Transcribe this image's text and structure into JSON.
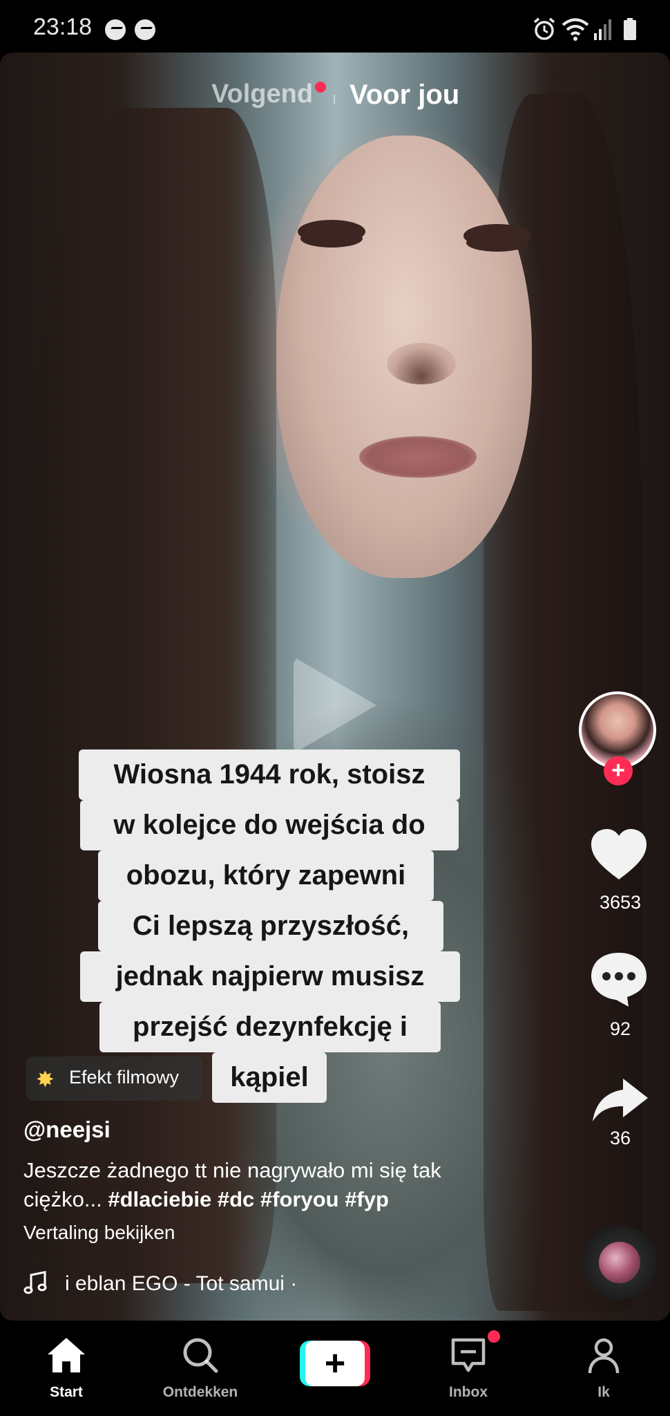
{
  "status_bar": {
    "time": "23:18",
    "left_icons": [
      "messenger-icon",
      "messenger-icon"
    ],
    "right_icons": [
      "alarm-icon",
      "wifi-icon",
      "signal-icon",
      "battery-icon"
    ]
  },
  "top_tabs": {
    "following": "Volgend",
    "for_you": "Voor jou",
    "following_has_new": true
  },
  "caption_lines": [
    "Wiosna 1944 rok, stoisz",
    "w kolejce do wejścia do",
    "obozu, który zapewni",
    "Ci lepszą przyszłość,",
    "jednak najpierw musisz",
    "przejść dezynfekcję i",
    "kąpiel"
  ],
  "effect": {
    "icon": "sparkle-icon",
    "label": "Efekt filmowy"
  },
  "post": {
    "username": "@neejsi",
    "description": "Jeszcze żadnego tt nie nagrywało  mi się tak ciężko...",
    "hashtags": "#dlaciebie #dc #foryou #fyp",
    "translate_label": "Vertaling bekijken",
    "music": "i eblan    EGO - Tot samui ·"
  },
  "actions": {
    "likes": "3653",
    "comments": "92",
    "shares": "36"
  },
  "bottom_nav": {
    "items": [
      {
        "label": "Start",
        "icon": "home-icon",
        "active": true
      },
      {
        "label": "Ontdekken",
        "icon": "search-icon",
        "active": false
      },
      {
        "label": "",
        "icon": "create-plus-icon",
        "active": false
      },
      {
        "label": "Inbox",
        "icon": "inbox-icon",
        "active": false
      },
      {
        "label": "Ik",
        "icon": "profile-icon",
        "active": false
      }
    ]
  },
  "colors": {
    "accent": "#fe2c55",
    "cyan": "#25f4ee",
    "background": "#000000"
  }
}
